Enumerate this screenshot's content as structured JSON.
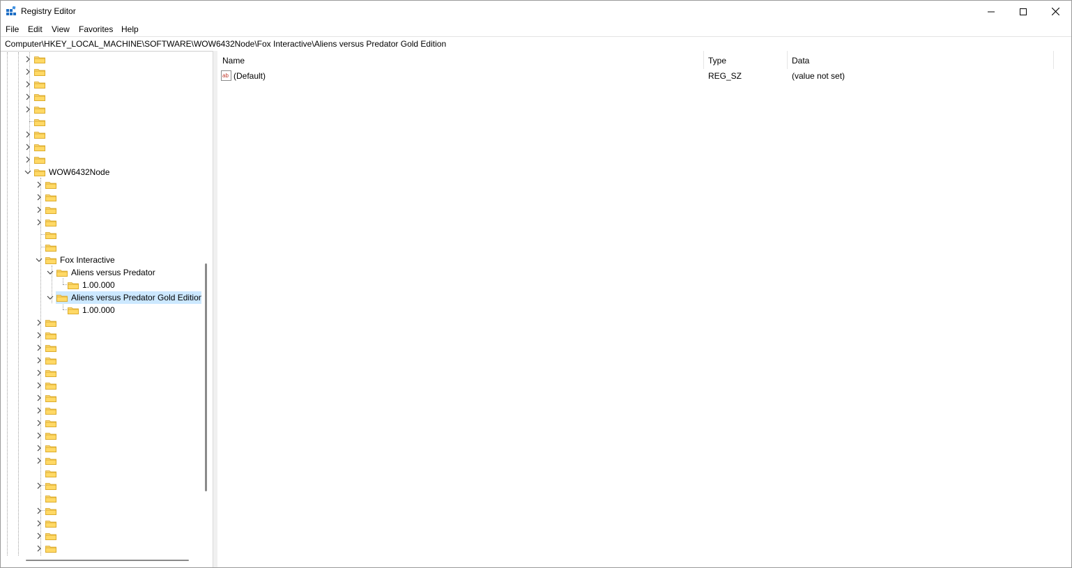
{
  "window": {
    "title": "Registry Editor"
  },
  "menu": [
    "File",
    "Edit",
    "View",
    "Favorites",
    "Help"
  ],
  "address": "Computer\\HKEY_LOCAL_MACHINE\\SOFTWARE\\WOW6432Node\\Fox Interactive\\Aliens versus Predator Gold Edition",
  "tree": {
    "wow_node": "WOW6432Node",
    "fox": "Fox Interactive",
    "avp": "Aliens versus Predator",
    "avp_ver": "1.00.000",
    "avp_gold": "Aliens versus Predator Gold Edition",
    "avp_gold_ver": "1.00.000"
  },
  "columns": {
    "name": "Name",
    "type": "Type",
    "data": "Data"
  },
  "values": [
    {
      "name": "(Default)",
      "type": "REG_SZ",
      "data": "(value not set)"
    }
  ]
}
